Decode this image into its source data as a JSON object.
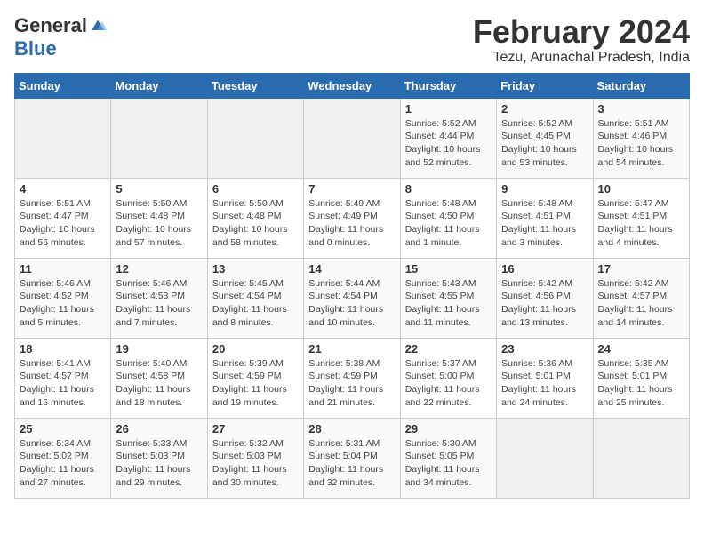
{
  "logo": {
    "general": "General",
    "blue": "Blue"
  },
  "title": {
    "main": "February 2024",
    "sub": "Tezu, Arunachal Pradesh, India"
  },
  "headers": [
    "Sunday",
    "Monday",
    "Tuesday",
    "Wednesday",
    "Thursday",
    "Friday",
    "Saturday"
  ],
  "weeks": [
    [
      {
        "day": "",
        "info": ""
      },
      {
        "day": "",
        "info": ""
      },
      {
        "day": "",
        "info": ""
      },
      {
        "day": "",
        "info": ""
      },
      {
        "day": "1",
        "info": "Sunrise: 5:52 AM\nSunset: 4:44 PM\nDaylight: 10 hours\nand 52 minutes."
      },
      {
        "day": "2",
        "info": "Sunrise: 5:52 AM\nSunset: 4:45 PM\nDaylight: 10 hours\nand 53 minutes."
      },
      {
        "day": "3",
        "info": "Sunrise: 5:51 AM\nSunset: 4:46 PM\nDaylight: 10 hours\nand 54 minutes."
      }
    ],
    [
      {
        "day": "4",
        "info": "Sunrise: 5:51 AM\nSunset: 4:47 PM\nDaylight: 10 hours\nand 56 minutes."
      },
      {
        "day": "5",
        "info": "Sunrise: 5:50 AM\nSunset: 4:48 PM\nDaylight: 10 hours\nand 57 minutes."
      },
      {
        "day": "6",
        "info": "Sunrise: 5:50 AM\nSunset: 4:48 PM\nDaylight: 10 hours\nand 58 minutes."
      },
      {
        "day": "7",
        "info": "Sunrise: 5:49 AM\nSunset: 4:49 PM\nDaylight: 11 hours\nand 0 minutes."
      },
      {
        "day": "8",
        "info": "Sunrise: 5:48 AM\nSunset: 4:50 PM\nDaylight: 11 hours\nand 1 minute."
      },
      {
        "day": "9",
        "info": "Sunrise: 5:48 AM\nSunset: 4:51 PM\nDaylight: 11 hours\nand 3 minutes."
      },
      {
        "day": "10",
        "info": "Sunrise: 5:47 AM\nSunset: 4:51 PM\nDaylight: 11 hours\nand 4 minutes."
      }
    ],
    [
      {
        "day": "11",
        "info": "Sunrise: 5:46 AM\nSunset: 4:52 PM\nDaylight: 11 hours\nand 5 minutes."
      },
      {
        "day": "12",
        "info": "Sunrise: 5:46 AM\nSunset: 4:53 PM\nDaylight: 11 hours\nand 7 minutes."
      },
      {
        "day": "13",
        "info": "Sunrise: 5:45 AM\nSunset: 4:54 PM\nDaylight: 11 hours\nand 8 minutes."
      },
      {
        "day": "14",
        "info": "Sunrise: 5:44 AM\nSunset: 4:54 PM\nDaylight: 11 hours\nand 10 minutes."
      },
      {
        "day": "15",
        "info": "Sunrise: 5:43 AM\nSunset: 4:55 PM\nDaylight: 11 hours\nand 11 minutes."
      },
      {
        "day": "16",
        "info": "Sunrise: 5:42 AM\nSunset: 4:56 PM\nDaylight: 11 hours\nand 13 minutes."
      },
      {
        "day": "17",
        "info": "Sunrise: 5:42 AM\nSunset: 4:57 PM\nDaylight: 11 hours\nand 14 minutes."
      }
    ],
    [
      {
        "day": "18",
        "info": "Sunrise: 5:41 AM\nSunset: 4:57 PM\nDaylight: 11 hours\nand 16 minutes."
      },
      {
        "day": "19",
        "info": "Sunrise: 5:40 AM\nSunset: 4:58 PM\nDaylight: 11 hours\nand 18 minutes."
      },
      {
        "day": "20",
        "info": "Sunrise: 5:39 AM\nSunset: 4:59 PM\nDaylight: 11 hours\nand 19 minutes."
      },
      {
        "day": "21",
        "info": "Sunrise: 5:38 AM\nSunset: 4:59 PM\nDaylight: 11 hours\nand 21 minutes."
      },
      {
        "day": "22",
        "info": "Sunrise: 5:37 AM\nSunset: 5:00 PM\nDaylight: 11 hours\nand 22 minutes."
      },
      {
        "day": "23",
        "info": "Sunrise: 5:36 AM\nSunset: 5:01 PM\nDaylight: 11 hours\nand 24 minutes."
      },
      {
        "day": "24",
        "info": "Sunrise: 5:35 AM\nSunset: 5:01 PM\nDaylight: 11 hours\nand 25 minutes."
      }
    ],
    [
      {
        "day": "25",
        "info": "Sunrise: 5:34 AM\nSunset: 5:02 PM\nDaylight: 11 hours\nand 27 minutes."
      },
      {
        "day": "26",
        "info": "Sunrise: 5:33 AM\nSunset: 5:03 PM\nDaylight: 11 hours\nand 29 minutes."
      },
      {
        "day": "27",
        "info": "Sunrise: 5:32 AM\nSunset: 5:03 PM\nDaylight: 11 hours\nand 30 minutes."
      },
      {
        "day": "28",
        "info": "Sunrise: 5:31 AM\nSunset: 5:04 PM\nDaylight: 11 hours\nand 32 minutes."
      },
      {
        "day": "29",
        "info": "Sunrise: 5:30 AM\nSunset: 5:05 PM\nDaylight: 11 hours\nand 34 minutes."
      },
      {
        "day": "",
        "info": ""
      },
      {
        "day": "",
        "info": ""
      }
    ]
  ]
}
